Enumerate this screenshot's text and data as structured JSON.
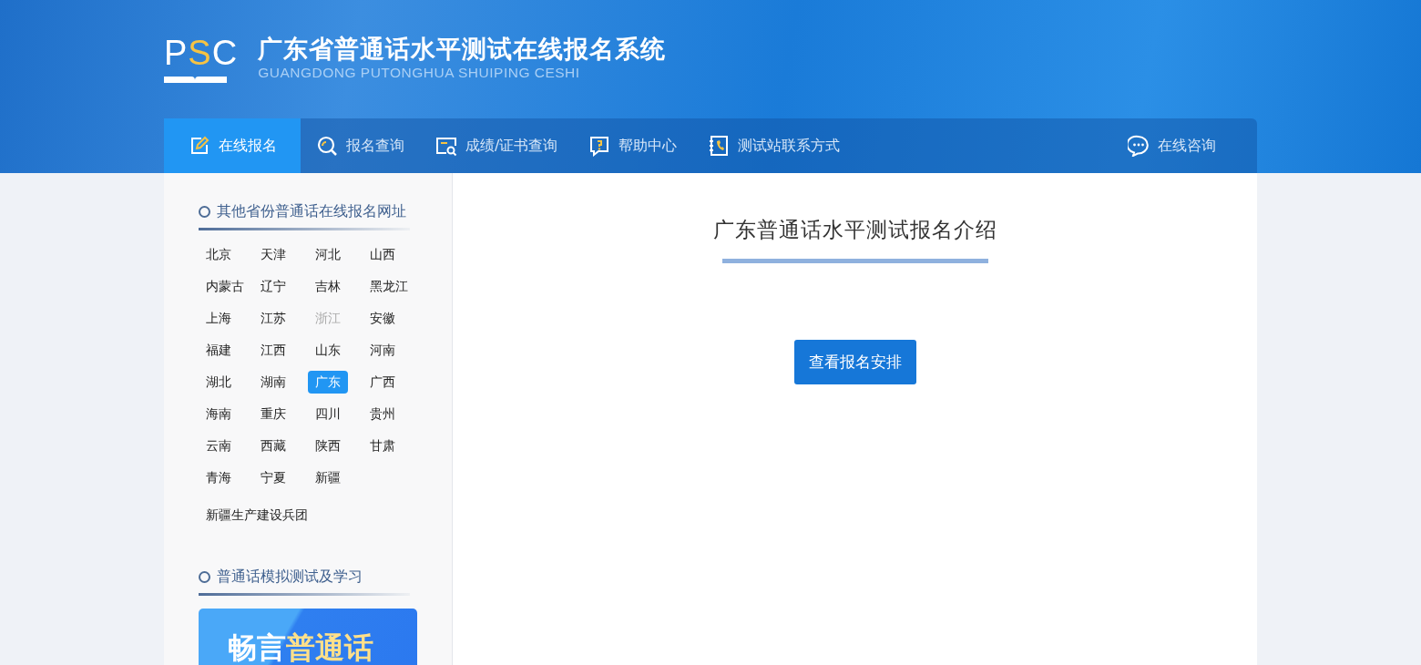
{
  "header": {
    "logo_letters": [
      {
        "text": "P",
        "highlight": false
      },
      {
        "text": "S",
        "highlight": true
      },
      {
        "text": "C",
        "highlight": false
      }
    ],
    "title": "广东省普通话水平测试在线报名系统",
    "subtitle": "GUANGDONG PUTONGHUA SHUIPING CESHI"
  },
  "nav": {
    "items": [
      {
        "label": "在线报名",
        "kind": "edit",
        "selected": true
      },
      {
        "label": "报名查询",
        "kind": "search",
        "selected": false
      },
      {
        "label": "成绩/证书查询",
        "kind": "certificate",
        "selected": false
      },
      {
        "label": "帮助中心",
        "kind": "help",
        "selected": false
      },
      {
        "label": "测试站联系方式",
        "kind": "phonebook",
        "selected": false
      }
    ],
    "consult": {
      "label": "在线咨询"
    }
  },
  "sidebar": {
    "provinces_title": "其他省份普通话在线报名网址",
    "provinces": [
      {
        "label": "北京",
        "selected": false,
        "disabled": false
      },
      {
        "label": "天津",
        "selected": false,
        "disabled": false
      },
      {
        "label": "河北",
        "selected": false,
        "disabled": false
      },
      {
        "label": "山西",
        "selected": false,
        "disabled": false
      },
      {
        "label": "内蒙古",
        "selected": false,
        "disabled": false
      },
      {
        "label": "辽宁",
        "selected": false,
        "disabled": false
      },
      {
        "label": "吉林",
        "selected": false,
        "disabled": false
      },
      {
        "label": "黑龙江",
        "selected": false,
        "disabled": false
      },
      {
        "label": "上海",
        "selected": false,
        "disabled": false
      },
      {
        "label": "江苏",
        "selected": false,
        "disabled": false
      },
      {
        "label": "浙江",
        "selected": false,
        "disabled": true
      },
      {
        "label": "安徽",
        "selected": false,
        "disabled": false
      },
      {
        "label": "福建",
        "selected": false,
        "disabled": false
      },
      {
        "label": "江西",
        "selected": false,
        "disabled": false
      },
      {
        "label": "山东",
        "selected": false,
        "disabled": false
      },
      {
        "label": "河南",
        "selected": false,
        "disabled": false
      },
      {
        "label": "湖北",
        "selected": false,
        "disabled": false
      },
      {
        "label": "湖南",
        "selected": false,
        "disabled": false
      },
      {
        "label": "广东",
        "selected": true,
        "disabled": false
      },
      {
        "label": "广西",
        "selected": false,
        "disabled": false
      },
      {
        "label": "海南",
        "selected": false,
        "disabled": false
      },
      {
        "label": "重庆",
        "selected": false,
        "disabled": false
      },
      {
        "label": "四川",
        "selected": false,
        "disabled": false
      },
      {
        "label": "贵州",
        "selected": false,
        "disabled": false
      },
      {
        "label": "云南",
        "selected": false,
        "disabled": false
      },
      {
        "label": "西藏",
        "selected": false,
        "disabled": false
      },
      {
        "label": "陕西",
        "selected": false,
        "disabled": false
      },
      {
        "label": "甘肃",
        "selected": false,
        "disabled": false
      },
      {
        "label": "青海",
        "selected": false,
        "disabled": false
      },
      {
        "label": "宁夏",
        "selected": false,
        "disabled": false
      },
      {
        "label": "新疆",
        "selected": false,
        "disabled": false
      }
    ],
    "extra_link": "新疆生产建设兵团",
    "study_title": "普通话模拟测试及学习",
    "banner": {
      "text": "畅言",
      "highlight": "普通话"
    }
  },
  "main": {
    "title": "广东普通话水平测试报名介绍",
    "button": "查看报名安排"
  }
}
